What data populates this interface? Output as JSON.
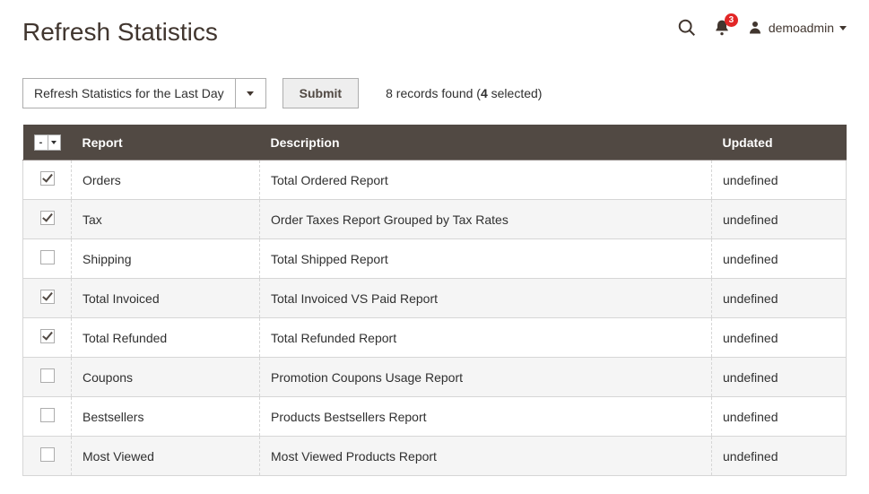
{
  "header": {
    "title": "Refresh Statistics",
    "notifications_count": "3",
    "account_name": "demoadmin"
  },
  "toolbar": {
    "action_select": "Refresh Statistics for the Last Day",
    "submit_label": "Submit",
    "records_total": "8",
    "records_selected": "4",
    "records_prefix": " records found (",
    "records_suffix": " selected)"
  },
  "columns": {
    "report": "Report",
    "description": "Description",
    "updated": "Updated"
  },
  "rows": [
    {
      "checked": true,
      "report": "Orders",
      "description": "Total Ordered Report",
      "updated": "undefined"
    },
    {
      "checked": true,
      "report": "Tax",
      "description": "Order Taxes Report Grouped by Tax Rates",
      "updated": "undefined"
    },
    {
      "checked": false,
      "report": "Shipping",
      "description": "Total Shipped Report",
      "updated": "undefined"
    },
    {
      "checked": true,
      "report": "Total Invoiced",
      "description": "Total Invoiced VS Paid Report",
      "updated": "undefined"
    },
    {
      "checked": true,
      "report": "Total Refunded",
      "description": "Total Refunded Report",
      "updated": "undefined"
    },
    {
      "checked": false,
      "report": "Coupons",
      "description": "Promotion Coupons Usage Report",
      "updated": "undefined"
    },
    {
      "checked": false,
      "report": "Bestsellers",
      "description": "Products Bestsellers Report",
      "updated": "undefined"
    },
    {
      "checked": false,
      "report": "Most Viewed",
      "description": "Most Viewed Products Report",
      "updated": "undefined"
    }
  ]
}
